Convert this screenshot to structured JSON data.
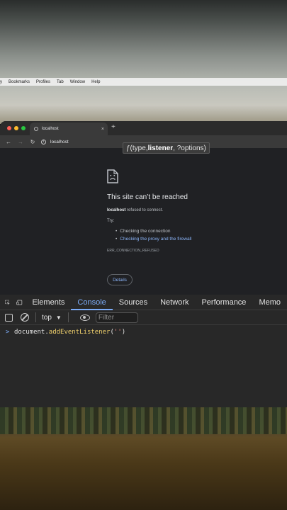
{
  "menubar": {
    "items": [
      "y",
      "Bookmarks",
      "Profiles",
      "Tab",
      "Window",
      "Help"
    ]
  },
  "browser": {
    "tab_title": "localhost",
    "tab_close": "×",
    "new_tab": "+",
    "url": "localhost",
    "traffic_lights": [
      "#ff5f57",
      "#febc2e",
      "#28c840"
    ]
  },
  "error_page": {
    "title": "This site can’t be reached",
    "host": "localhost",
    "message": " refused to connect.",
    "try_label": "Try:",
    "suggestions": [
      "Checking the connection",
      "Checking the proxy and the firewall"
    ],
    "error_code": "ERR_CONNECTION_REFUSED",
    "details_button": "Details"
  },
  "devtools": {
    "tabs": [
      "Elements",
      "Console",
      "Sources",
      "Network",
      "Performance",
      "Memo"
    ],
    "active_tab": "Console",
    "context": "top",
    "filter_placeholder": "Filter",
    "console_input": {
      "prompt": ">",
      "object": "document",
      "dot": ".",
      "method": "addEventListener",
      "args_open": "(",
      "string": "''",
      "args_close": ")"
    },
    "tooltip": {
      "prefix": "ƒ(type, ",
      "param_bold": "listener",
      "suffix": ", ?options)"
    }
  },
  "colors": {
    "accent": "#7cacf8",
    "link": "#8ab4f8",
    "page_bg": "#202124"
  }
}
